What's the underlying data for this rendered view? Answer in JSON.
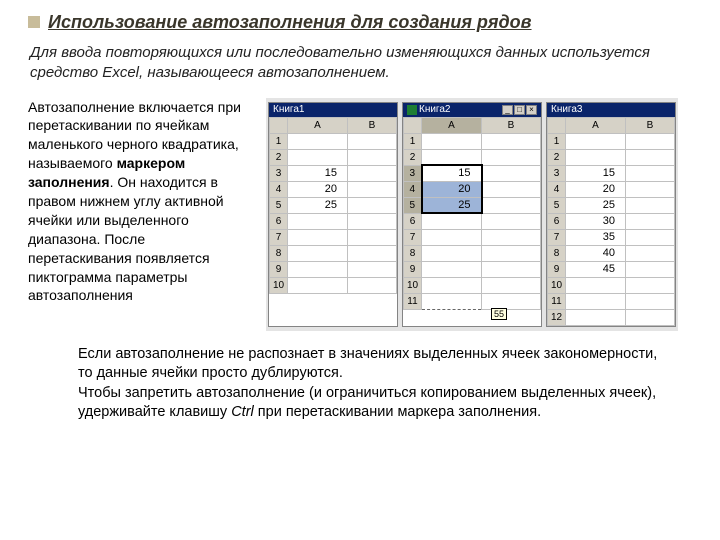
{
  "title": "Использование автозаполнения для создания рядов",
  "intro": "Для ввода повторяющихся или последовательно изменяющихся данных используется средство Excel, называющееся автозаполнением.",
  "desc_parts": {
    "p1": "Автозаполнение включается при перетаскивании по ячейкам маленького черного квадратика, называемого ",
    "bold": "маркером заполнения",
    "p2": ". Он находится в правом нижнем углу активной ячейки или выделенного диапазона. После перетаскивания появляется пиктограмма параметры автозаполнения"
  },
  "sheets": {
    "left": {
      "title": "Книга1",
      "cols": [
        "A",
        "B"
      ],
      "rows": [
        "1",
        "2",
        "3",
        "4",
        "5",
        "6",
        "7",
        "8",
        "9",
        "10"
      ],
      "data": {
        "3": "15",
        "4": "20",
        "5": "25"
      }
    },
    "middle": {
      "title": "Книга2",
      "cols": [
        "A",
        "B"
      ],
      "rows": [
        "1",
        "2",
        "3",
        "4",
        "5",
        "6",
        "7",
        "8",
        "9",
        "10",
        "11"
      ],
      "data": {
        "3": "15",
        "4": "20",
        "5": "25"
      },
      "tooltip": "55"
    },
    "right": {
      "title": "Книга3",
      "cols": [
        "A",
        "B"
      ],
      "rows": [
        "1",
        "2",
        "3",
        "4",
        "5",
        "6",
        "7",
        "8",
        "9",
        "10",
        "11",
        "12"
      ],
      "data": {
        "3": "15",
        "4": "20",
        "5": "25",
        "6": "30",
        "7": "35",
        "8": "40",
        "9": "45"
      }
    }
  },
  "conclusion": {
    "para1": "Если автозаполнение не распознает в значениях выделенных ячеек закономерности, то данные ячейки просто дублируются.",
    "para2a": "Чтобы запретить автозаполнение (и ограничиться копированием выделенных ячеек), удерживайте клавишу ",
    "ctrl": "Ctrl",
    "para2b": " при перетаскивании маркера заполнения."
  }
}
